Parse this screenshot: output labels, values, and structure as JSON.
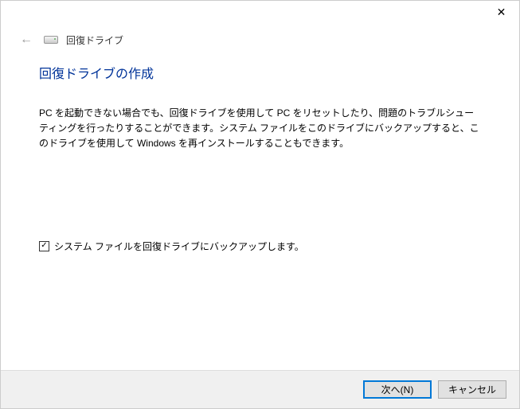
{
  "titlebar": {
    "close_glyph": "✕"
  },
  "header": {
    "title": "回復ドライブ"
  },
  "page": {
    "title": "回復ドライブの作成",
    "description": "PC を起動できない場合でも、回復ドライブを使用して PC をリセットしたり、問題のトラブルシューティングを行ったりすることができます。システム ファイルをこのドライブにバックアップすると、このドライブを使用して Windows を再インストールすることもできます。"
  },
  "checkbox": {
    "checked_glyph": "✓",
    "label": "システム ファイルを回復ドライブにバックアップします。"
  },
  "footer": {
    "next": "次へ(N)",
    "cancel": "キャンセル"
  }
}
